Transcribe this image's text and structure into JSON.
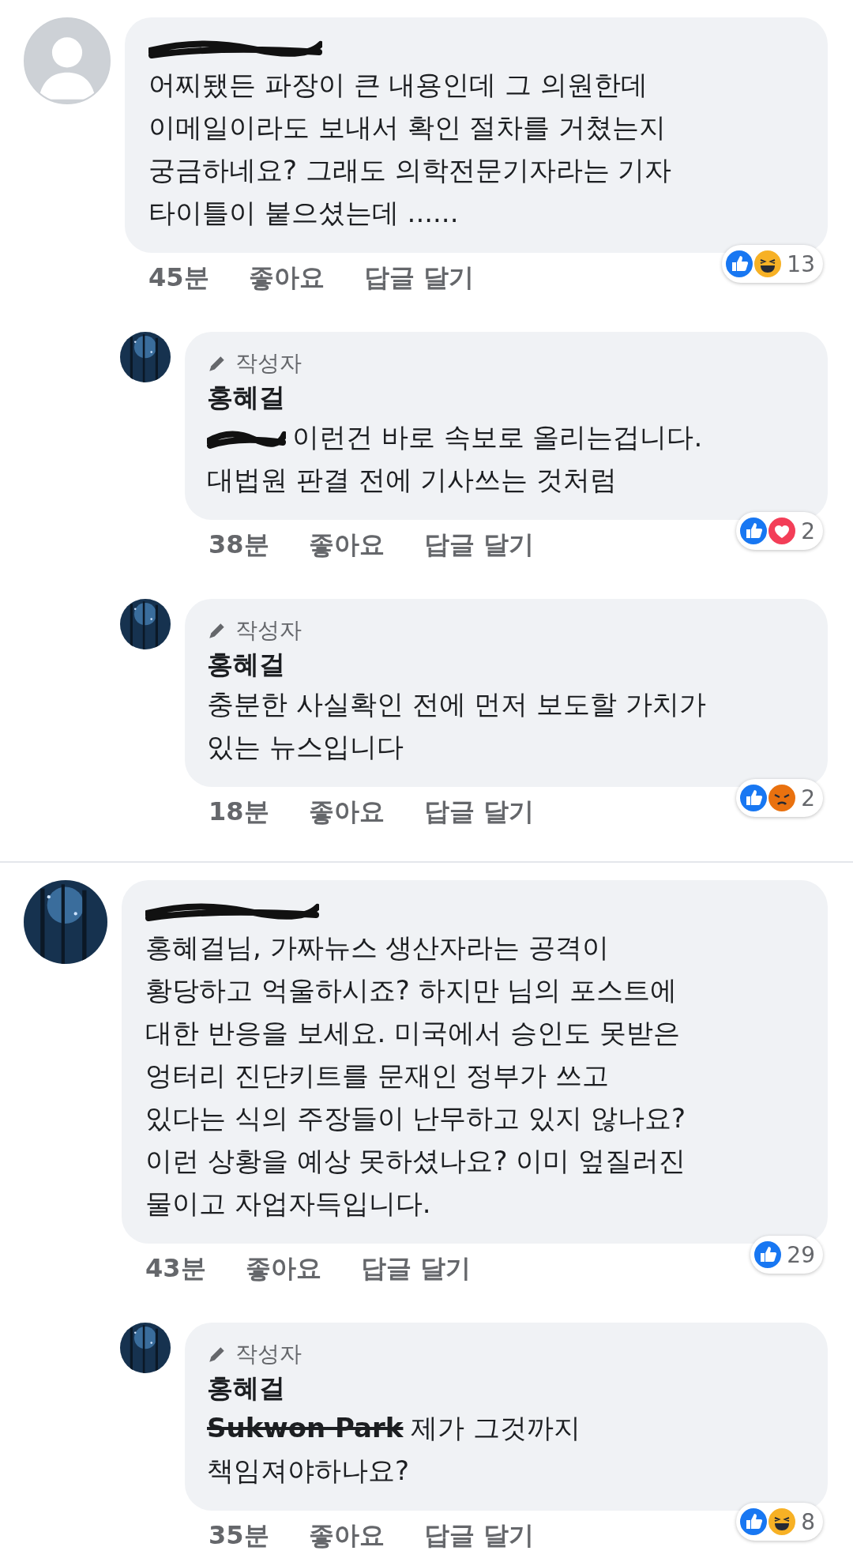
{
  "threads": [
    {
      "avatar": {
        "kind": "default"
      },
      "name_scribbled": true,
      "lines": [
        "어찌됐든 파장이 큰 내용인데 그 의원한데",
        "이메일이라도 보내서 확인 절차를 거쳤는지",
        "궁금하네요? 그래도 의학전문기자라는 기자",
        "타이틀이 붙으셨는데 ......"
      ],
      "time": "45분",
      "actions": [
        "좋아요",
        "답글 달기"
      ],
      "reactions": {
        "icons": [
          {
            "kind": "like"
          },
          {
            "kind": "haha"
          }
        ],
        "count": "13"
      },
      "replies": [
        {
          "avatar": {
            "kind": "picture"
          },
          "badge": "작성자",
          "name": "홍혜걸",
          "mention": {
            "scribbled": true
          },
          "lines": [
            "이런건 바로 속보로 올리는겁니다.",
            "대법원 판결 전에 기사쓰는 것처럼"
          ],
          "time": "38분",
          "actions": [
            "좋아요",
            "답글 달기"
          ],
          "reactions": {
            "icons": [
              {
                "kind": "like"
              },
              {
                "kind": "love"
              }
            ],
            "count": "2"
          }
        },
        {
          "avatar": {
            "kind": "picture"
          },
          "badge": "작성자",
          "name": "홍혜걸",
          "lines": [
            "충분한 사실확인 전에 먼저 보도할 가치가",
            "있는 뉴스입니다"
          ],
          "time": "18분",
          "actions": [
            "좋아요",
            "답글 달기"
          ],
          "reactions": {
            "icons": [
              {
                "kind": "like"
              },
              {
                "kind": "angry"
              }
            ],
            "count": "2"
          }
        }
      ]
    },
    {
      "avatar": {
        "kind": "picture"
      },
      "name_scribbled": true,
      "lines": [
        "홍혜걸님, 가짜뉴스 생산자라는 공격이",
        "황당하고 억울하시죠? 하지만 님의 포스트에",
        "대한 반응을 보세요. 미국에서 승인도 못받은",
        "엉터리 진단키트를 문재인 정부가 쓰고",
        "있다는 식의 주장들이 난무하고 있지 않나요?",
        "이런 상황을 예상 못하셨나요? 이미 엎질러진",
        "물이고 자업자득입니다."
      ],
      "time": "43분",
      "actions": [
        "좋아요",
        "답글 달기"
      ],
      "reactions": {
        "icons": [
          {
            "kind": "like"
          }
        ],
        "count": "29"
      },
      "replies": [
        {
          "avatar": {
            "kind": "picture"
          },
          "badge": "작성자",
          "name": "홍혜걸",
          "mention": {
            "text": "Sukwon Park",
            "scribbled": true
          },
          "lines": [
            "제가 그것까지",
            "책임져야하나요?"
          ],
          "time": "35분",
          "actions": [
            "좋아요",
            "답글 달기"
          ],
          "reactions": {
            "icons": [
              {
                "kind": "like"
              },
              {
                "kind": "haha"
              }
            ],
            "count": "8"
          }
        }
      ]
    }
  ]
}
